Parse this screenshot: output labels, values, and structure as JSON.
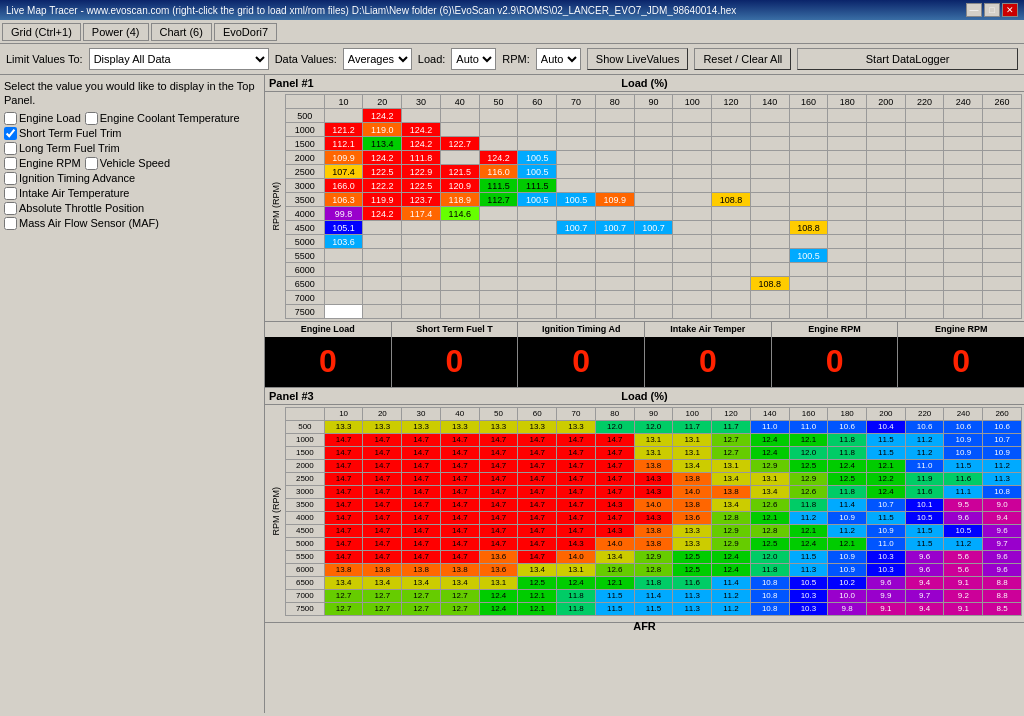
{
  "title_bar": {
    "text": "Live Map Tracer - www.evoscan.com (right-click the grid to load xml/rom files) D:\\Liam\\New folder (6)\\EvoScan v2.9\\ROMS\\02_LANCER_EVO7_JDM_98640014.hex"
  },
  "title_buttons": [
    "—",
    "□",
    "✕"
  ],
  "menu_tabs": [
    {
      "label": "Grid (Ctrl+1)",
      "active": false
    },
    {
      "label": "Power (4)",
      "active": false
    },
    {
      "label": "Chart (6)",
      "active": false
    },
    {
      "label": "EvoDori7",
      "active": false
    }
  ],
  "toolbar": {
    "limit_label": "Limit Values To:",
    "limit_select": "Display All Data",
    "data_values_label": "Data Values:",
    "data_values_select": "Averages",
    "load_label": "Load:",
    "load_select": "Auto",
    "rpm_label": "RPM:",
    "rpm_select": "Auto",
    "show_live_button": "Show LiveValues",
    "reset_button": "Reset / Clear All",
    "start_logger_button": "Start DataLogger"
  },
  "left_panel": {
    "description": "Select the value you would like to display in the Top Panel.",
    "checkboxes": [
      {
        "label": "Engine Load",
        "checked": false,
        "col": 1
      },
      {
        "label": "Engine Coolant Temperature",
        "checked": false,
        "col": 2
      },
      {
        "label": "Short Term Fuel Trim",
        "checked": true,
        "col": 1
      },
      {
        "label": "Long Term Fuel Trim",
        "checked": false,
        "col": 1
      },
      {
        "label": "Engine RPM",
        "checked": false,
        "col": 1
      },
      {
        "label": "Vehicle Speed",
        "checked": false,
        "col": 2
      },
      {
        "label": "Ignition Timing Advance",
        "checked": false,
        "col": 1
      },
      {
        "label": "Intake Air Temperature",
        "checked": false,
        "col": 1
      },
      {
        "label": "Absolute Throttle Position",
        "checked": false,
        "col": 1
      },
      {
        "label": "Mass Air Flow Sensor (MAF)",
        "checked": false,
        "col": 1
      }
    ]
  },
  "panel1": {
    "title": "Panel #1",
    "load_label": "Load (%)",
    "load_headers": [
      "10",
      "20",
      "30",
      "40",
      "50",
      "60",
      "70",
      "80",
      "90",
      "100",
      "120",
      "140",
      "160",
      "180",
      "200",
      "220",
      "240",
      "260"
    ],
    "rpm_label": "RPM (RPM)",
    "rpm_rows": [
      {
        "rpm": "500",
        "values": [
          "",
          "124.2",
          "",
          "",
          "",
          "",
          "",
          "",
          "",
          "",
          "",
          "",
          "",
          "",
          "",
          "",
          "",
          ""
        ]
      },
      {
        "rpm": "1000",
        "values": [
          "121.2",
          "119.0",
          "124.2",
          "",
          "",
          "",
          "",
          "",
          "",
          "",
          "",
          "",
          "",
          "",
          "",
          "",
          "",
          ""
        ]
      },
      {
        "rpm": "1500",
        "values": [
          "112.1",
          "113.4",
          "124.2",
          "122.7",
          "",
          "",
          "",
          "",
          "",
          "",
          "",
          "",
          "",
          "",
          "",
          "",
          "",
          ""
        ]
      },
      {
        "rpm": "2000",
        "values": [
          "109.9",
          "124.2",
          "111.8",
          "",
          "124.2",
          "100.5",
          "",
          "",
          "",
          "",
          "",
          "",
          "",
          "",
          "",
          "",
          "",
          ""
        ]
      },
      {
        "rpm": "2500",
        "values": [
          "107.4",
          "122.5",
          "122.9",
          "121.5",
          "116.0",
          "100.5",
          "",
          "",
          "",
          "",
          "",
          "",
          "",
          "",
          "",
          "",
          "",
          ""
        ]
      },
      {
        "rpm": "3000",
        "values": [
          "166.0",
          "122.2",
          "122.5",
          "120.9",
          "111.5",
          "111.5",
          "",
          "",
          "",
          "",
          "",
          "",
          "",
          "",
          "",
          "",
          "",
          ""
        ]
      },
      {
        "rpm": "3500",
        "values": [
          "106.3",
          "119.9",
          "123.7",
          "118.9",
          "112.7",
          "100.5",
          "100.5",
          "109.9",
          "",
          "",
          "108.8",
          "",
          "",
          "",
          "",
          "",
          "",
          ""
        ]
      },
      {
        "rpm": "4000",
        "values": [
          "99.8",
          "124.2",
          "117.4",
          "114.6",
          "",
          "",
          "",
          "",
          "",
          "",
          "",
          "",
          "",
          "",
          "",
          "",
          "",
          ""
        ]
      },
      {
        "rpm": "4500",
        "values": [
          "105.1",
          "",
          "",
          "",
          "",
          "",
          "100.7",
          "100.7",
          "100.7",
          "",
          "",
          "",
          "108.8",
          "",
          "",
          "",
          "",
          ""
        ]
      },
      {
        "rpm": "5000",
        "values": [
          "103.6",
          "",
          "",
          "",
          "",
          "",
          "",
          "",
          "",
          "",
          "",
          "",
          "",
          "",
          "",
          "",
          "",
          ""
        ]
      },
      {
        "rpm": "5500",
        "values": [
          "",
          "",
          "",
          "",
          "",
          "",
          "",
          "",
          "",
          "",
          "",
          "",
          "100.5",
          "",
          "",
          "",
          "",
          ""
        ]
      },
      {
        "rpm": "6000",
        "values": [
          "",
          "",
          "",
          "",
          "",
          "",
          "",
          "",
          "",
          "",
          "",
          "",
          "",
          "",
          "",
          "",
          "",
          ""
        ]
      },
      {
        "rpm": "6500",
        "values": [
          "",
          "",
          "",
          "",
          "",
          "",
          "",
          "",
          "",
          "",
          "",
          "108.8",
          "",
          "",
          "",
          "",
          "",
          ""
        ]
      },
      {
        "rpm": "7000",
        "values": [
          "",
          "",
          "",
          "",
          "",
          "",
          "",
          "",
          "",
          "",
          "",
          "",
          "",
          "",
          "",
          "",
          "",
          ""
        ]
      },
      {
        "rpm": "7500",
        "values": [
          "",
          "",
          "",
          "",
          "",
          "",
          "",
          "",
          "",
          "",
          "",
          "",
          "",
          "",
          "",
          "",
          "",
          ""
        ]
      }
    ]
  },
  "gauges": [
    {
      "label": "Engine Load",
      "value": "0"
    },
    {
      "label": "Short Term Fuel T",
      "value": "0"
    },
    {
      "label": "Ignition Timing Ad",
      "value": "0"
    },
    {
      "label": "Intake Air Temper",
      "value": "0"
    },
    {
      "label": "Engine RPM",
      "value": "0"
    },
    {
      "label": "Engine RPM",
      "value": "0"
    }
  ],
  "panel3": {
    "title": "Panel #3",
    "load_label": "Load (%)",
    "load_headers": [
      "10",
      "20",
      "30",
      "40",
      "50",
      "60",
      "70",
      "80",
      "90",
      "100",
      "120",
      "140",
      "160",
      "180",
      "200",
      "220",
      "240",
      "260"
    ],
    "rpm_label": "RPM (RPM)",
    "rpm_rows": [
      {
        "rpm": "500",
        "values": [
          "13.3",
          "13.3",
          "13.3",
          "13.3",
          "13.3",
          "13.3",
          "13.3",
          "12.0",
          "12.0",
          "11.7",
          "11.7",
          "11.0",
          "11.0",
          "10.6",
          "10.4",
          "10.6",
          "10.6",
          "10.6"
        ]
      },
      {
        "rpm": "1000",
        "values": [
          "14.7",
          "14.7",
          "14.7",
          "14.7",
          "14.7",
          "14.7",
          "14.7",
          "14.7",
          "13.1",
          "13.1",
          "12.7",
          "12.4",
          "12.1",
          "11.8",
          "11.5",
          "11.2",
          "10.9",
          "10.7"
        ]
      },
      {
        "rpm": "1500",
        "values": [
          "14.7",
          "14.7",
          "14.7",
          "14.7",
          "14.7",
          "14.7",
          "14.7",
          "14.7",
          "13.1",
          "13.1",
          "12.7",
          "12.4",
          "12.0",
          "11.8",
          "11.5",
          "11.2",
          "10.9",
          "10.9"
        ]
      },
      {
        "rpm": "2000",
        "values": [
          "14.7",
          "14.7",
          "14.7",
          "14.7",
          "14.7",
          "14.7",
          "14.7",
          "14.7",
          "13.8",
          "13.4",
          "13.1",
          "12.9",
          "12.5",
          "12.4",
          "12.1",
          "11.0",
          "11.5",
          "11.2"
        ]
      },
      {
        "rpm": "2500",
        "values": [
          "14.7",
          "14.7",
          "14.7",
          "14.7",
          "14.7",
          "14.7",
          "14.7",
          "14.7",
          "14.3",
          "13.8",
          "13.4",
          "13.1",
          "12.9",
          "12.5",
          "12.2",
          "11.9",
          "11.6",
          "11.3"
        ]
      },
      {
        "rpm": "3000",
        "values": [
          "14.7",
          "14.7",
          "14.7",
          "14.7",
          "14.7",
          "14.7",
          "14.7",
          "14.7",
          "14.3",
          "14.0",
          "13.8",
          "13.4",
          "12.6",
          "11.8",
          "12.4",
          "11.6",
          "11.1",
          "10.8"
        ]
      },
      {
        "rpm": "3500",
        "values": [
          "14.7",
          "14.7",
          "14.7",
          "14.7",
          "14.7",
          "14.7",
          "14.7",
          "14.3",
          "14.0",
          "13.8",
          "13.4",
          "12.6",
          "11.8",
          "11.4",
          "10.7",
          "10.1",
          "9.5",
          "9.0"
        ]
      },
      {
        "rpm": "4000",
        "values": [
          "14.7",
          "14.7",
          "14.7",
          "14.7",
          "14.7",
          "14.7",
          "14.7",
          "14.7",
          "14.3",
          "13.6",
          "12.8",
          "12.1",
          "11.2",
          "10.9",
          "11.5",
          "10.5",
          "9.6",
          "9.4"
        ]
      },
      {
        "rpm": "4500",
        "values": [
          "14.7",
          "14.7",
          "14.7",
          "14.7",
          "14.7",
          "14.7",
          "14.7",
          "14.3",
          "13.8",
          "13.3",
          "12.9",
          "12.8",
          "12.1",
          "11.2",
          "10.9",
          "11.5",
          "10.5",
          "9.6"
        ]
      },
      {
        "rpm": "5000",
        "values": [
          "14.7",
          "14.7",
          "14.7",
          "14.7",
          "14.7",
          "14.7",
          "14.3",
          "14.0",
          "13.8",
          "13.3",
          "12.9",
          "12.5",
          "12.4",
          "12.1",
          "11.0",
          "11.5",
          "11.2",
          "9.7"
        ]
      },
      {
        "rpm": "5500",
        "values": [
          "14.7",
          "14.7",
          "14.7",
          "14.7",
          "13.6",
          "14.7",
          "14.0",
          "13.4",
          "12.9",
          "12.5",
          "12.4",
          "12.0",
          "11.5",
          "10.9",
          "10.3",
          "9.6",
          "5.6",
          "9.6"
        ]
      },
      {
        "rpm": "6000",
        "values": [
          "13.8",
          "13.8",
          "13.8",
          "13.8",
          "13.6",
          "13.4",
          "13.1",
          "12.6",
          "12.8",
          "12.5",
          "12.4",
          "11.8",
          "11.3",
          "10.9",
          "10.3",
          "9.6",
          "5.6",
          "9.6"
        ]
      },
      {
        "rpm": "6500",
        "values": [
          "13.4",
          "13.4",
          "13.4",
          "13.4",
          "13.1",
          "12.5",
          "12.4",
          "12.1",
          "11.8",
          "11.6",
          "11.4",
          "10.8",
          "10.5",
          "10.2",
          "9.6",
          "9.4",
          "9.1",
          "8.8"
        ]
      },
      {
        "rpm": "7000",
        "values": [
          "12.7",
          "12.7",
          "12.7",
          "12.7",
          "12.4",
          "12.1",
          "11.8",
          "11.5",
          "11.4",
          "11.3",
          "11.2",
          "10.8",
          "10.3",
          "10.0",
          "9.9",
          "9.7",
          "9.2",
          "8.8"
        ]
      },
      {
        "rpm": "7500",
        "values": [
          "12.7",
          "12.7",
          "12.7",
          "12.7",
          "12.4",
          "12.1",
          "11.8",
          "11.5",
          "11.5",
          "11.3",
          "11.2",
          "10.8",
          "10.3",
          "9.8",
          "9.1",
          "9.4",
          "9.1",
          "8.5"
        ]
      }
    ],
    "footer_label": "AFR"
  }
}
